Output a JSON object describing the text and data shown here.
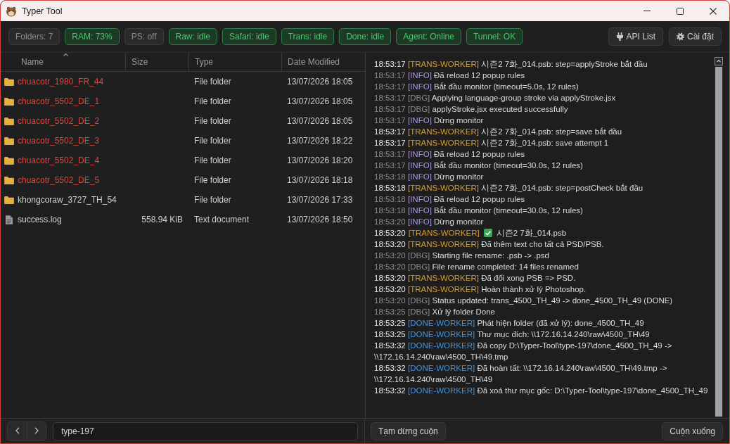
{
  "window": {
    "title": "Typer Tool"
  },
  "status_badges": [
    {
      "label": "Folders: 7",
      "kind": "neutral"
    },
    {
      "label": "RAM: 73%",
      "kind": "ok"
    },
    {
      "label": "PS: off",
      "kind": "neutral"
    },
    {
      "label": "Raw: idle",
      "kind": "ok"
    },
    {
      "label": "Safari: idle",
      "kind": "ok"
    },
    {
      "label": "Trans: idle",
      "kind": "ok"
    },
    {
      "label": "Done: idle",
      "kind": "ok"
    },
    {
      "label": "Agent: Online",
      "kind": "ok"
    },
    {
      "label": "Tunnel: OK",
      "kind": "ok"
    }
  ],
  "toolbar_buttons": [
    {
      "label": "API List",
      "kind": "plug"
    },
    {
      "label": "Cài đặt",
      "kind": "gear"
    }
  ],
  "file_list": {
    "columns": [
      {
        "label": "Name",
        "sorted": true
      },
      {
        "label": "Size",
        "sorted": false
      },
      {
        "label": "Type",
        "sorted": false
      },
      {
        "label": "Date Modified",
        "sorted": false
      }
    ],
    "rows": [
      {
        "kind": "folder",
        "name": "chuacotr_1980_FR_44",
        "color": "#e0443e",
        "type": "File folder",
        "date": "13/07/2026 18:05"
      },
      {
        "kind": "folder",
        "name": "chuacotr_5502_DE_1",
        "color": "#e0443e",
        "type": "File folder",
        "date": "13/07/2026 18:05"
      },
      {
        "kind": "folder",
        "name": "chuacotr_5502_DE_2",
        "color": "#e0443e",
        "type": "File folder",
        "date": "13/07/2026 18:05"
      },
      {
        "kind": "folder",
        "name": "chuacotr_5502_DE_3",
        "color": "#e0443e",
        "type": "File folder",
        "date": "13/07/2026 18:22"
      },
      {
        "kind": "folder",
        "name": "chuacotr_5502_DE_4",
        "color": "#e0443e",
        "type": "File folder",
        "date": "13/07/2026 18:20"
      },
      {
        "kind": "folder",
        "name": "chuacotr_5502_DE_5",
        "color": "#e0443e",
        "type": "File folder",
        "date": "13/07/2026 18:18"
      },
      {
        "kind": "folder",
        "name": "khongcoraw_3727_TH_54",
        "color": "#d4d4d4",
        "type": "File folder",
        "date": "13/07/2026 17:33"
      },
      {
        "kind": "file",
        "name": "success.log",
        "color": "#d4d4d4",
        "size": "558.94 KiB",
        "type": "Text document",
        "date": "13/07/2026 18:50"
      }
    ]
  },
  "log": {
    "lines": [
      {
        "time": "18:53:17",
        "tag": "[TRANS-WORKER]",
        "kind": "trans",
        "text": "시즌2 7화_014.psb: step=applyStroke bắt đầu"
      },
      {
        "time": "18:53:17",
        "tag": "[INFO]",
        "kind": "info",
        "text": "Đã reload 12 popup rules"
      },
      {
        "time": "18:53:17",
        "tag": "[INFO]",
        "kind": "info",
        "text": "Bắt đầu monitor (timeout=5.0s, 12 rules)"
      },
      {
        "time": "18:53:17",
        "tag": "[DBG]",
        "kind": "dbg",
        "text": "Applying language-group stroke via applyStroke.jsx"
      },
      {
        "time": "18:53:17",
        "tag": "[DBG]",
        "kind": "dbg",
        "text": "applyStroke.jsx executed successfully"
      },
      {
        "time": "18:53:17",
        "tag": "[INFO]",
        "kind": "info",
        "text": "Dừng monitor"
      },
      {
        "time": "18:53:17",
        "tag": "[TRANS-WORKER]",
        "kind": "trans",
        "text": "시즌2 7화_014.psb: step=save bắt đầu"
      },
      {
        "time": "18:53:17",
        "tag": "[TRANS-WORKER]",
        "kind": "trans",
        "text": "시즌2 7화_014.psb: save attempt 1"
      },
      {
        "time": "18:53:17",
        "tag": "[INFO]",
        "kind": "info",
        "text": "Đã reload 12 popup rules"
      },
      {
        "time": "18:53:17",
        "tag": "[INFO]",
        "kind": "info",
        "text": "Bắt đầu monitor (timeout=30.0s, 12 rules)"
      },
      {
        "time": "18:53:18",
        "tag": "[INFO]",
        "kind": "info",
        "text": "Dừng monitor"
      },
      {
        "time": "18:53:18",
        "tag": "[TRANS-WORKER]",
        "kind": "trans",
        "text": "시즌2 7화_014.psb: step=postCheck bắt đầu"
      },
      {
        "time": "18:53:18",
        "tag": "[INFO]",
        "kind": "info",
        "text": "Đã reload 12 popup rules"
      },
      {
        "time": "18:53:18",
        "tag": "[INFO]",
        "kind": "info",
        "text": "Bắt đầu monitor (timeout=30.0s, 12 rules)"
      },
      {
        "time": "18:53:20",
        "tag": "[INFO]",
        "kind": "info",
        "text": "Dừng monitor"
      },
      {
        "time": "18:53:20",
        "tag": "[TRANS-WORKER]",
        "kind": "trans",
        "check_mark": true,
        "text": "시즌2 7화_014.psb"
      },
      {
        "time": "18:53:20",
        "tag": "[TRANS-WORKER]",
        "kind": "trans",
        "text": "Đã thêm text cho tất cả PSD/PSB."
      },
      {
        "time": "18:53:20",
        "tag": "[DBG]",
        "kind": "dbg",
        "text": "Starting file rename: .psb -> .psd"
      },
      {
        "time": "18:53:20",
        "tag": "[DBG]",
        "kind": "dbg",
        "text": "File rename completed: 14 files renamed"
      },
      {
        "time": "18:53:20",
        "tag": "[TRANS-WORKER]",
        "kind": "trans",
        "text": "Đã đổi xong PSB => PSD."
      },
      {
        "time": "18:53:20",
        "tag": "[TRANS-WORKER]",
        "kind": "trans",
        "text": "Hoàn thành xử lý Photoshop."
      },
      {
        "time": "18:53:20",
        "tag": "[DBG]",
        "kind": "dbg",
        "text": "Status updated: trans_4500_TH_49 -> done_4500_TH_49 (DONE)"
      },
      {
        "time": "18:53:25",
        "tag": "[DBG]",
        "kind": "dbg",
        "text": "Xử lý folder Done"
      },
      {
        "time": "18:53:25",
        "tag": "[DONE-WORKER]",
        "kind": "done",
        "text": "Phát hiện folder (đã xử lý): done_4500_TH_49"
      },
      {
        "time": "18:53:25",
        "tag": "[DONE-WORKER]",
        "kind": "done",
        "text": "Thư mục đích: \\\\172.16.14.240\\raw\\4500_TH\\49"
      },
      {
        "time": "18:53:32",
        "tag": "[DONE-WORKER]",
        "kind": "done",
        "text": "Đã copy D:\\Typer-Tool\\type-197\\done_4500_TH_49 -> \\\\172.16.14.240\\raw\\4500_TH\\49.tmp"
      },
      {
        "time": "18:53:32",
        "tag": "[DONE-WORKER]",
        "kind": "done",
        "text": "Đã hoàn tất: \\\\172.16.14.240\\raw\\4500_TH\\49.tmp -> \\\\172.16.14.240\\raw\\4500_TH\\49"
      },
      {
        "time": "18:53:32",
        "tag": "[DONE-WORKER]",
        "kind": "done",
        "text": "Đã xoá thư mục gốc: D:\\Typer-Tool\\type-197\\done_4500_TH_49"
      }
    ]
  },
  "bottom_bar": {
    "path": "type-197",
    "buttons": [
      "Tạm dừng cuộn",
      "Cuộn xuống"
    ]
  }
}
